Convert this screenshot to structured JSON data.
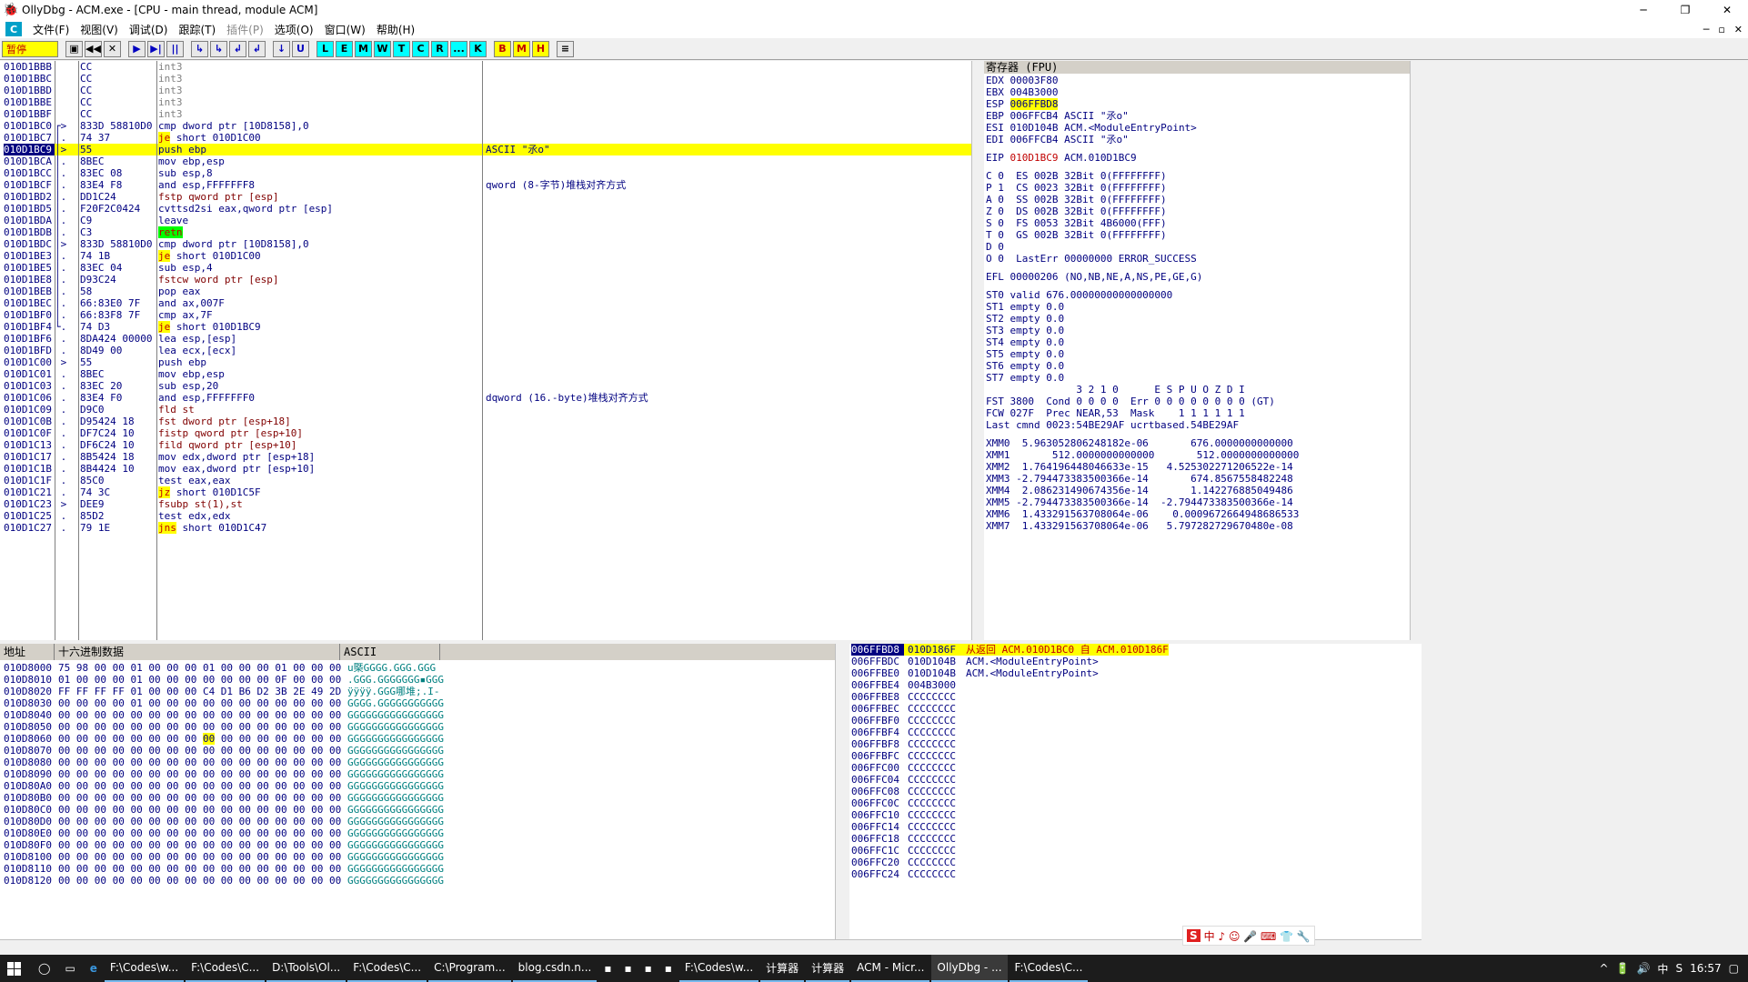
{
  "window": {
    "title": "OllyDbg - ACM.exe - [CPU - main thread, module ACM]",
    "min": "─",
    "max": "❐",
    "close": "✕",
    "mdi_min": "─",
    "mdi_max": "▫",
    "mdi_close": "✕"
  },
  "menu": {
    "logo": "C",
    "items": [
      "文件(F)",
      "视图(V)",
      "调试(D)",
      "跟踪(T)",
      "插件(P)",
      "选项(O)",
      "窗口(W)",
      "帮助(H)"
    ]
  },
  "toolbar": {
    "status": "暂停",
    "buttons": [
      "▣",
      "◀◀",
      "✕",
      "▶",
      "▶|",
      "||",
      "↳",
      "↳",
      "↲",
      "↲",
      "↓",
      "U",
      "L",
      "E",
      "M",
      "W",
      "T",
      "C",
      "R",
      "...",
      "K",
      "B",
      "M",
      "H",
      "≡"
    ]
  },
  "disasm": {
    "rows": [
      {
        "addr": "010D1BBB",
        "arr": "",
        "hex": "CC",
        "asm": "int3",
        "cmt": "",
        "k": "g"
      },
      {
        "addr": "010D1BBC",
        "arr": "",
        "hex": "CC",
        "asm": "int3",
        "cmt": "",
        "k": "g"
      },
      {
        "addr": "010D1BBD",
        "arr": "",
        "hex": "CC",
        "asm": "int3",
        "cmt": "",
        "k": "g"
      },
      {
        "addr": "010D1BBE",
        "arr": "",
        "hex": "CC",
        "asm": "int3",
        "cmt": "",
        "k": "g"
      },
      {
        "addr": "010D1BBF",
        "arr": "",
        "hex": "CC",
        "asm": "int3",
        "cmt": "",
        "k": "g"
      },
      {
        "addr": "010D1BC0",
        "arr": "┌>",
        "hex": "833D 58810D0",
        "asm": "cmp dword ptr [10D8158],0",
        "cmt": "",
        "k": ""
      },
      {
        "addr": "010D1BC7",
        "arr": "│.",
        "hex": "74 37",
        "asm": "je short 010D1C00",
        "cmt": "",
        "k": "j"
      },
      {
        "addr": "010D1BC9",
        "arr": "│>",
        "hex": "55",
        "asm": "push ebp",
        "cmt": "ASCII \"氶o\"",
        "k": "cur"
      },
      {
        "addr": "010D1BCA",
        "arr": "│.",
        "hex": "8BEC",
        "asm": "mov ebp,esp",
        "cmt": "",
        "k": ""
      },
      {
        "addr": "010D1BCC",
        "arr": "│.",
        "hex": "83EC 08",
        "asm": "sub esp,8",
        "cmt": "",
        "k": ""
      },
      {
        "addr": "010D1BCF",
        "arr": "│.",
        "hex": "83E4 F8",
        "asm": "and esp,FFFFFFF8",
        "cmt": "qword (8-字节)堆栈对齐方式",
        "k": ""
      },
      {
        "addr": "010D1BD2",
        "arr": "│.",
        "hex": "DD1C24",
        "asm": "fstp qword ptr [esp]",
        "cmt": "",
        "k": "f"
      },
      {
        "addr": "010D1BD5",
        "arr": "│.",
        "hex": "F20F2C0424",
        "asm": "cvttsd2si eax,qword ptr [esp]",
        "cmt": "",
        "k": ""
      },
      {
        "addr": "010D1BDA",
        "arr": "│.",
        "hex": "C9",
        "asm": "leave",
        "cmt": "",
        "k": ""
      },
      {
        "addr": "010D1BDB",
        "arr": "│.",
        "hex": "C3",
        "asm": "retn",
        "cmt": "",
        "k": "r"
      },
      {
        "addr": "010D1BDC",
        "arr": "│>",
        "hex": "833D 58810D0",
        "asm": "cmp dword ptr [10D8158],0",
        "cmt": "",
        "k": ""
      },
      {
        "addr": "010D1BE3",
        "arr": "│.",
        "hex": "74 1B",
        "asm": "je short 010D1C00",
        "cmt": "",
        "k": "j"
      },
      {
        "addr": "010D1BE5",
        "arr": "│.",
        "hex": "83EC 04",
        "asm": "sub esp,4",
        "cmt": "",
        "k": ""
      },
      {
        "addr": "010D1BE8",
        "arr": "│.",
        "hex": "D93C24",
        "asm": "fstcw word ptr [esp]",
        "cmt": "",
        "k": "f"
      },
      {
        "addr": "010D1BEB",
        "arr": "│.",
        "hex": "58",
        "asm": "pop eax",
        "cmt": "",
        "k": ""
      },
      {
        "addr": "010D1BEC",
        "arr": "│.",
        "hex": "66:83E0 7F",
        "asm": "and ax,007F",
        "cmt": "",
        "k": ""
      },
      {
        "addr": "010D1BF0",
        "arr": "│.",
        "hex": "66:83F8 7F",
        "asm": "cmp ax,7F",
        "cmt": "",
        "k": ""
      },
      {
        "addr": "010D1BF4",
        "arr": "└.",
        "hex": "74 D3",
        "asm": "je short 010D1BC9",
        "cmt": "",
        "k": "j"
      },
      {
        "addr": "010D1BF6",
        "arr": " .",
        "hex": "8DA424 00000",
        "asm": "lea esp,[esp]",
        "cmt": "",
        "k": ""
      },
      {
        "addr": "010D1BFD",
        "arr": " .",
        "hex": "8D49 00",
        "asm": "lea ecx,[ecx]",
        "cmt": "",
        "k": ""
      },
      {
        "addr": "010D1C00",
        "arr": " >",
        "hex": "55",
        "asm": "push ebp",
        "cmt": "",
        "k": ""
      },
      {
        "addr": "010D1C01",
        "arr": " .",
        "hex": "8BEC",
        "asm": "mov ebp,esp",
        "cmt": "",
        "k": ""
      },
      {
        "addr": "010D1C03",
        "arr": " .",
        "hex": "83EC 20",
        "asm": "sub esp,20",
        "cmt": "",
        "k": ""
      },
      {
        "addr": "010D1C06",
        "arr": " .",
        "hex": "83E4 F0",
        "asm": "and esp,FFFFFFF0",
        "cmt": "dqword (16.-byte)堆栈对齐方式",
        "k": ""
      },
      {
        "addr": "010D1C09",
        "arr": " .",
        "hex": "D9C0",
        "asm": "fld st",
        "cmt": "",
        "k": "f"
      },
      {
        "addr": "010D1C0B",
        "arr": " .",
        "hex": "D95424 18",
        "asm": "fst dword ptr [esp+18]",
        "cmt": "",
        "k": "f"
      },
      {
        "addr": "010D1C0F",
        "arr": " .",
        "hex": "DF7C24 10",
        "asm": "fistp qword ptr [esp+10]",
        "cmt": "",
        "k": "f"
      },
      {
        "addr": "010D1C13",
        "arr": " .",
        "hex": "DF6C24 10",
        "asm": "fild qword ptr [esp+10]",
        "cmt": "",
        "k": "f"
      },
      {
        "addr": "010D1C17",
        "arr": " .",
        "hex": "8B5424 18",
        "asm": "mov edx,dword ptr [esp+18]",
        "cmt": "",
        "k": ""
      },
      {
        "addr": "010D1C1B",
        "arr": " .",
        "hex": "8B4424 10",
        "asm": "mov eax,dword ptr [esp+10]",
        "cmt": "",
        "k": ""
      },
      {
        "addr": "010D1C1F",
        "arr": " .",
        "hex": "85C0",
        "asm": "test eax,eax",
        "cmt": "",
        "k": ""
      },
      {
        "addr": "010D1C21",
        "arr": " .",
        "hex": "74 3C",
        "asm": "jz short 010D1C5F",
        "cmt": "",
        "k": "j"
      },
      {
        "addr": "010D1C23",
        "arr": " >",
        "hex": "DEE9",
        "asm": "fsubp st(1),st",
        "cmt": "",
        "k": "f"
      },
      {
        "addr": "010D1C25",
        "arr": " .",
        "hex": "85D2",
        "asm": "test edx,edx",
        "cmt": "",
        "k": ""
      },
      {
        "addr": "010D1C27",
        "arr": " .",
        "hex": "79 1E",
        "asm": "jns short 010D1C47",
        "cmt": "",
        "k": "j"
      }
    ]
  },
  "registers": {
    "header": "寄存器 (FPU)",
    "gpr": [
      {
        "name": "EDX",
        "val": "00003F80",
        "note": "",
        "hl": false
      },
      {
        "name": "EBX",
        "val": "004B3000",
        "note": "",
        "hl": false
      },
      {
        "name": "ESP",
        "val": "006FFBD8",
        "note": "",
        "hl": true
      },
      {
        "name": "EBP",
        "val": "006FFCB4",
        "note": "ASCII \"氶o\"",
        "hl": false
      },
      {
        "name": "ESI",
        "val": "010D104B",
        "note": "ACM.<ModuleEntryPoint>",
        "hl": false
      },
      {
        "name": "EDI",
        "val": "006FFCB4",
        "note": "ASCII \"氶o\"",
        "hl": false
      }
    ],
    "eip": {
      "name": "EIP",
      "val": "010D1BC9",
      "note": "ACM.010D1BC9"
    },
    "flags": [
      "C 0  ES 002B 32Bit 0(FFFFFFFF)",
      "P 1  CS 0023 32Bit 0(FFFFFFFF)",
      "A 0  SS 002B 32Bit 0(FFFFFFFF)",
      "Z 0  DS 002B 32Bit 0(FFFFFFFF)",
      "S 0  FS 0053 32Bit 4B6000(FFF)",
      "T 0  GS 002B 32Bit 0(FFFFFFFF)",
      "D 0",
      "O 0  LastErr 00000000 ERROR_SUCCESS"
    ],
    "efl": "EFL 00000206 (NO,NB,NE,A,NS,PE,GE,G)",
    "st": [
      "ST0 valid 676.00000000000000000",
      "ST1 empty 0.0",
      "ST2 empty 0.0",
      "ST3 empty 0.0",
      "ST4 empty 0.0",
      "ST5 empty 0.0",
      "ST6 empty 0.0",
      "ST7 empty 0.0"
    ],
    "fpu": [
      "               3 2 1 0      E S P U O Z D I",
      "FST 3800  Cond 0 0 0 0  Err 0 0 0 0 0 0 0 0 (GT)",
      "FCW 027F  Prec NEAR,53  Mask    1 1 1 1 1 1",
      "Last cmnd 0023:54BE29AF ucrtbased.54BE29AF"
    ],
    "xmm": [
      "XMM0  5.963052806248182e-06       676.0000000000000",
      "XMM1       512.0000000000000       512.0000000000000",
      "XMM2  1.764196448046633e-15   4.525302271206522e-14",
      "XMM3 -2.794473383500366e-14       674.8567558482248",
      "XMM4  2.086231490674356e-14       1.142276885049486",
      "XMM5 -2.794473383500366e-14  -2.794473383500366e-14",
      "XMM6  1.433291563708064e-06    0.0009672664948686533",
      "XMM7  1.433291563708064e-06   5.797282729670480e-08"
    ]
  },
  "dump": {
    "headers": [
      "地址",
      "十六进制数据",
      "ASCII"
    ],
    "rows": [
      {
        "addr": "010D8000",
        "hex": "75 98 00 00 01 00 00 00 01 00 00 00 01 00 00 00",
        "asc": "u槩GGGG.GGG.GGG"
      },
      {
        "addr": "010D8010",
        "hex": "01 00 00 00 01 00 00 00 00 00 00 00 0F 00 00 00",
        "asc": ".GGG.GGGGGGG▪GGG"
      },
      {
        "addr": "010D8020",
        "hex": "FF FF FF FF 01 00 00 00 C4 D1 B6 D2 3B 2E 49 2D",
        "asc": "ÿÿÿÿ.GGG哪堆;.I-"
      },
      {
        "addr": "010D8030",
        "hex": "00 00 00 00 01 00 00 00 00 00 00 00 00 00 00 00",
        "asc": "GGGG.GGGGGGGGGGG"
      },
      {
        "addr": "010D8040",
        "hex": "00 00 00 00 00 00 00 00 00 00 00 00 00 00 00 00",
        "asc": "GGGGGGGGGGGGGGGG"
      },
      {
        "addr": "010D8050",
        "hex": "00 00 00 00 00 00 00 00 00 00 00 00 00 00 00 00",
        "asc": "GGGGGGGGGGGGGGGG"
      },
      {
        "addr": "010D8060",
        "hex": "00 00 00 00 00 00 00 00 00 00 00 00 00 00 00 00",
        "asc": "GGGGGGGGGGGGGGGG",
        "hl": 8
      },
      {
        "addr": "010D8070",
        "hex": "00 00 00 00 00 00 00 00 00 00 00 00 00 00 00 00",
        "asc": "GGGGGGGGGGGGGGGG"
      },
      {
        "addr": "010D8080",
        "hex": "00 00 00 00 00 00 00 00 00 00 00 00 00 00 00 00",
        "asc": "GGGGGGGGGGGGGGGG"
      },
      {
        "addr": "010D8090",
        "hex": "00 00 00 00 00 00 00 00 00 00 00 00 00 00 00 00",
        "asc": "GGGGGGGGGGGGGGGG"
      },
      {
        "addr": "010D80A0",
        "hex": "00 00 00 00 00 00 00 00 00 00 00 00 00 00 00 00",
        "asc": "GGGGGGGGGGGGGGGG"
      },
      {
        "addr": "010D80B0",
        "hex": "00 00 00 00 00 00 00 00 00 00 00 00 00 00 00 00",
        "asc": "GGGGGGGGGGGGGGGG"
      },
      {
        "addr": "010D80C0",
        "hex": "00 00 00 00 00 00 00 00 00 00 00 00 00 00 00 00",
        "asc": "GGGGGGGGGGGGGGGG"
      },
      {
        "addr": "010D80D0",
        "hex": "00 00 00 00 00 00 00 00 00 00 00 00 00 00 00 00",
        "asc": "GGGGGGGGGGGGGGGG"
      },
      {
        "addr": "010D80E0",
        "hex": "00 00 00 00 00 00 00 00 00 00 00 00 00 00 00 00",
        "asc": "GGGGGGGGGGGGGGGG"
      },
      {
        "addr": "010D80F0",
        "hex": "00 00 00 00 00 00 00 00 00 00 00 00 00 00 00 00",
        "asc": "GGGGGGGGGGGGGGGG"
      },
      {
        "addr": "010D8100",
        "hex": "00 00 00 00 00 00 00 00 00 00 00 00 00 00 00 00",
        "asc": "GGGGGGGGGGGGGGGG"
      },
      {
        "addr": "010D8110",
        "hex": "00 00 00 00 00 00 00 00 00 00 00 00 00 00 00 00",
        "asc": "GGGGGGGGGGGGGGGG"
      },
      {
        "addr": "010D8120",
        "hex": "00 00 00 00 00 00 00 00 00 00 00 00 00 00 00 00",
        "asc": "GGGGGGGGGGGGGGGG"
      }
    ]
  },
  "stack": {
    "rows": [
      {
        "addr": "006FFBD8",
        "val": "010D186F",
        "cmt": "从返回 ACM.010D1BC0 自 ACM.010D186F",
        "cur": true
      },
      {
        "addr": "006FFBDC",
        "val": "010D104B",
        "cmt": "ACM.<ModuleEntryPoint>",
        "cur": false
      },
      {
        "addr": "006FFBE0",
        "val": "010D104B",
        "cmt": "ACM.<ModuleEntryPoint>",
        "cur": false
      },
      {
        "addr": "006FFBE4",
        "val": "004B3000",
        "cmt": "",
        "cur": false
      },
      {
        "addr": "006FFBE8",
        "val": "CCCCCCCC",
        "cmt": "",
        "cur": false
      },
      {
        "addr": "006FFBEC",
        "val": "CCCCCCCC",
        "cmt": "",
        "cur": false
      },
      {
        "addr": "006FFBF0",
        "val": "CCCCCCCC",
        "cmt": "",
        "cur": false
      },
      {
        "addr": "006FFBF4",
        "val": "CCCCCCCC",
        "cmt": "",
        "cur": false
      },
      {
        "addr": "006FFBF8",
        "val": "CCCCCCCC",
        "cmt": "",
        "cur": false
      },
      {
        "addr": "006FFBFC",
        "val": "CCCCCCCC",
        "cmt": "",
        "cur": false
      },
      {
        "addr": "006FFC00",
        "val": "CCCCCCCC",
        "cmt": "",
        "cur": false
      },
      {
        "addr": "006FFC04",
        "val": "CCCCCCCC",
        "cmt": "",
        "cur": false
      },
      {
        "addr": "006FFC08",
        "val": "CCCCCCCC",
        "cmt": "",
        "cur": false
      },
      {
        "addr": "006FFC0C",
        "val": "CCCCCCCC",
        "cmt": "",
        "cur": false
      },
      {
        "addr": "006FFC10",
        "val": "CCCCCCCC",
        "cmt": "",
        "cur": false
      },
      {
        "addr": "006FFC14",
        "val": "CCCCCCCC",
        "cmt": "",
        "cur": false
      },
      {
        "addr": "006FFC18",
        "val": "CCCCCCCC",
        "cmt": "",
        "cur": false
      },
      {
        "addr": "006FFC1C",
        "val": "CCCCCCCC",
        "cmt": "",
        "cur": false
      },
      {
        "addr": "006FFC20",
        "val": "CCCCCCCC",
        "cmt": "",
        "cur": false
      },
      {
        "addr": "006FFC24",
        "val": "CCCCCCCC",
        "cmt": "",
        "cur": false
      }
    ]
  },
  "ime": {
    "logo": "S",
    "text": "中 ♪ ☺ 🎤 ⌨ 👕 🔧"
  },
  "taskbar": {
    "apps": [
      {
        "label": "F:\\Codes\\w...",
        "active": false
      },
      {
        "label": "F:\\Codes\\C...",
        "active": false
      },
      {
        "label": "D:\\Tools\\Ol...",
        "active": false
      },
      {
        "label": "F:\\Codes\\C...",
        "active": false
      },
      {
        "label": "C:\\Program...",
        "active": false
      },
      {
        "label": "blog.csdn.n...",
        "active": false
      },
      {
        "label": "",
        "active": false
      },
      {
        "label": "",
        "active": false
      },
      {
        "label": "",
        "active": false
      },
      {
        "label": "",
        "active": false
      },
      {
        "label": "F:\\Codes\\w...",
        "active": false
      },
      {
        "label": "计算器",
        "active": false
      },
      {
        "label": "计算器",
        "active": false
      },
      {
        "label": "ACM - Micr...",
        "active": false
      },
      {
        "label": "OllyDbg - ...",
        "active": true
      },
      {
        "label": "F:\\Codes\\C...",
        "active": false
      }
    ],
    "tray": [
      "^",
      "🔋",
      "🔊",
      "中",
      "S"
    ],
    "time": "16:57"
  }
}
